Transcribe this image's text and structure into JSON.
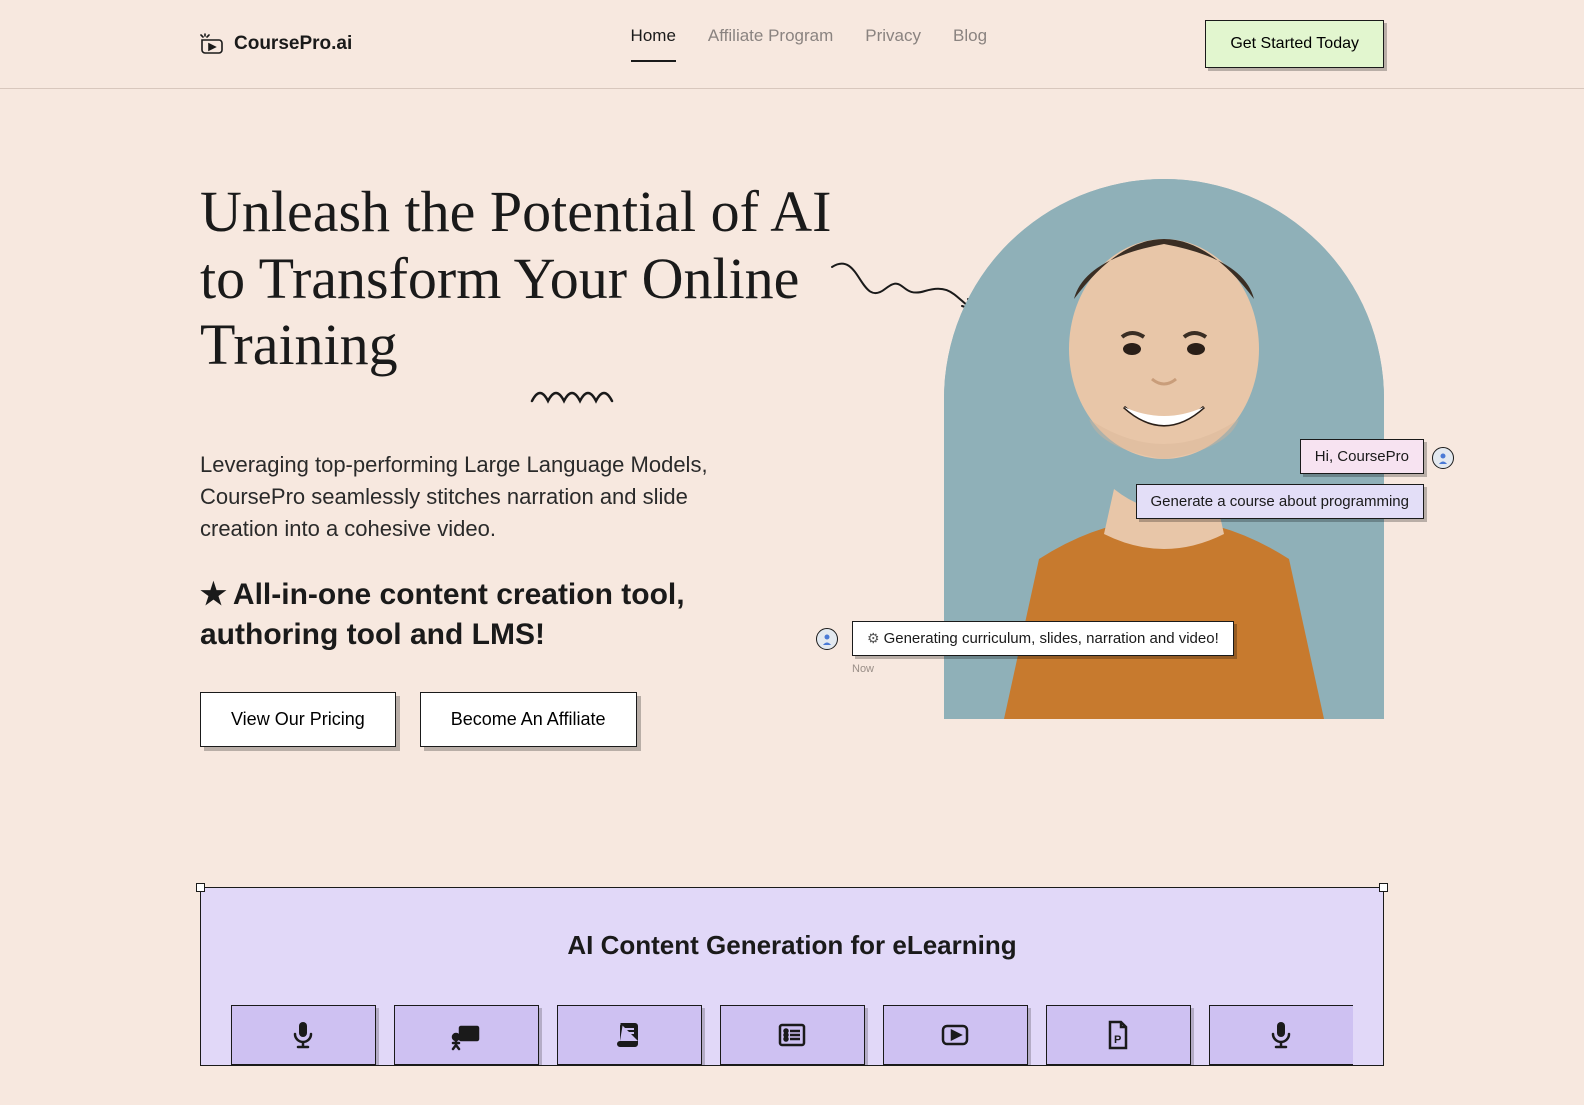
{
  "brand": "CoursePro.ai",
  "nav": {
    "items": [
      {
        "label": "Home",
        "active": true
      },
      {
        "label": "Affiliate Program",
        "active": false
      },
      {
        "label": "Privacy",
        "active": false
      },
      {
        "label": "Blog",
        "active": false
      }
    ],
    "cta": "Get Started Today"
  },
  "hero": {
    "title": "Unleash the Potential of AI to Transform Your Online Training",
    "subtitle": "Leveraging top-performing Large Language Models, CoursePro seamlessly stitches narration and slide creation into a cohesive video.",
    "star": "★",
    "callout": "All-in-one content creation tool, authoring tool and LMS!",
    "buttons": {
      "pricing": "View Our Pricing",
      "affiliate": "Become An Affiliate"
    },
    "chat": {
      "hi": "Hi, CoursePro",
      "prompt": "Generate a course about programming",
      "status": "Generating curriculum, slides, narration and video!",
      "timestamp": "Now"
    }
  },
  "section2": {
    "title": "AI Content Generation for eLearning",
    "icons": [
      "microphone",
      "presentation",
      "book",
      "list",
      "video",
      "file-p",
      "microphone"
    ]
  },
  "colors": {
    "bg": "#f7e8df",
    "cta_bg": "#e2f6cf",
    "lav": "#e1d8f8",
    "lav_dark": "#cec1f2",
    "pink": "#f7e3f1"
  }
}
